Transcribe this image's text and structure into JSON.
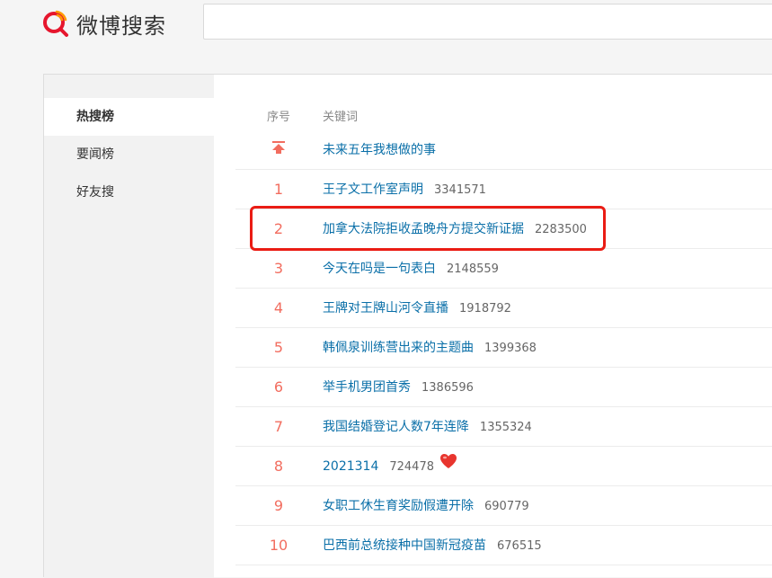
{
  "header": {
    "logo_text": "微博搜索",
    "search": {
      "value": "",
      "placeholder": ""
    }
  },
  "sidebar": {
    "items": [
      {
        "label": "热搜榜",
        "active": true
      },
      {
        "label": "要闻榜",
        "active": false
      },
      {
        "label": "好友搜",
        "active": false
      }
    ]
  },
  "table": {
    "headers": {
      "rank": "序号",
      "keyword": "关键词"
    },
    "rows": [
      {
        "rank": "",
        "icon": "pin-top-icon",
        "keyword": "未来五年我想做的事",
        "hits": ""
      },
      {
        "rank": "1",
        "keyword": "王子文工作室声明",
        "hits": "3341571"
      },
      {
        "rank": "2",
        "keyword": "加拿大法院拒收孟晚舟方提交新证据",
        "hits": "2283500"
      },
      {
        "rank": "3",
        "keyword": "今天在吗是一句表白",
        "hits": "2148559"
      },
      {
        "rank": "4",
        "keyword": "王牌对王牌山河令直播",
        "hits": "1918792"
      },
      {
        "rank": "5",
        "keyword": "韩佩泉训练营出来的主题曲",
        "hits": "1399368"
      },
      {
        "rank": "6",
        "keyword": "举手机男团首秀",
        "hits": "1386596"
      },
      {
        "rank": "7",
        "keyword": "我国结婚登记人数7年连降",
        "hits": "1355324"
      },
      {
        "rank": "8",
        "keyword": "2021314",
        "hits": "724478",
        "icon": "heart-icon"
      },
      {
        "rank": "9",
        "keyword": "女职工休生育奖励假遭开除",
        "hits": "690779"
      },
      {
        "rank": "10",
        "keyword": "巴西前总统接种中国新冠疫苗",
        "hits": "676515"
      }
    ]
  },
  "colors": {
    "rank": "#f26d5f",
    "link": "#0a6fa8",
    "highlight": "#ea1c14",
    "logo_accent": "#e6162d",
    "logo_orange": "#ff9a00"
  }
}
